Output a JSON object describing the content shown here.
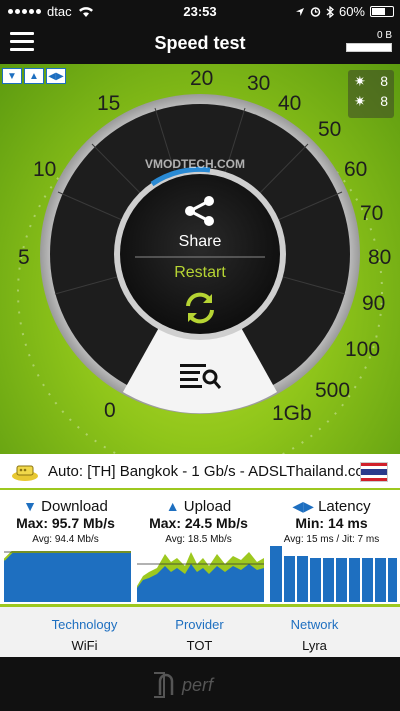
{
  "status_bar": {
    "carrier": "dtac",
    "time": "23:53",
    "battery": "60%"
  },
  "nav": {
    "title": "Speed test",
    "data_used": "0 B"
  },
  "gauge": {
    "scale_labels": [
      "0",
      "5",
      "10",
      "15",
      "20",
      "30",
      "40",
      "50",
      "60",
      "70",
      "80",
      "90",
      "100",
      "500",
      "1Gb"
    ],
    "watermark": "VMODTECH.COM",
    "share_label": "Share",
    "restart_label": "Restart",
    "servers_top": "8",
    "servers_bottom": "8"
  },
  "server": {
    "text": "Auto: [TH] Bangkok - 1 Gb/s - ADSLThailand.com"
  },
  "stats": {
    "download": {
      "title": "Download",
      "max": "Max: 95.7 Mb/s",
      "avg": "Avg: 94.4 Mb/s"
    },
    "upload": {
      "title": "Upload",
      "max": "Max: 24.5 Mb/s",
      "avg": "Avg: 18.5 Mb/s"
    },
    "latency": {
      "title": "Latency",
      "min": "Min: 14 ms",
      "avg": "Avg: 15 ms / Jit: 7 ms"
    }
  },
  "info": {
    "technology": {
      "label": "Technology",
      "value": "WiFi"
    },
    "provider": {
      "label": "Provider",
      "value": "TOT"
    },
    "network": {
      "label": "Network",
      "value": "Lyra"
    }
  },
  "footer": {
    "logo": "nperf"
  },
  "colors": {
    "accent_blue": "#1e6fc0",
    "accent_green": "#9dc81f",
    "restart_green": "#b6d433"
  }
}
